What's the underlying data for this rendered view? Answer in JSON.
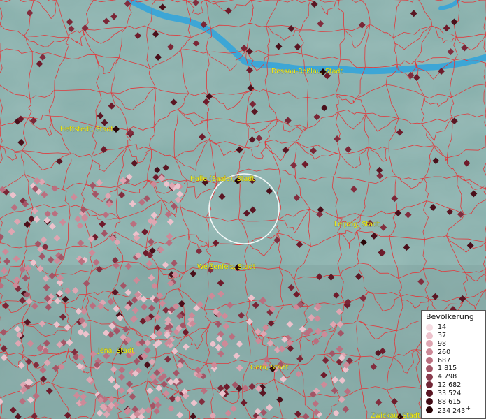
{
  "map": {
    "cities": [
      {
        "id": "dessau",
        "label": "Dessau-Roßlau, Stadt"
      },
      {
        "id": "hettstedt",
        "label": "Hettstedt, Stadt"
      },
      {
        "id": "halle",
        "label": "Halle (Saale), Stadt"
      },
      {
        "id": "leipzig",
        "label": "Leipzig, Stadt"
      },
      {
        "id": "weissenfels",
        "label": "Weißenfels, Stadt"
      },
      {
        "id": "jena",
        "label": "Jena, Stadt"
      },
      {
        "id": "gera",
        "label": "Gera, Stadt"
      },
      {
        "id": "zwickau",
        "label": "Zwickau, Stadt"
      }
    ],
    "colors": {
      "terrain": "#8fb5b0",
      "water": "#3da6d6",
      "boundaries": "#e0393c",
      "labels": "#f5f017",
      "focus_circle": "#ffffff"
    }
  },
  "legend": {
    "title": "Bevölkerung",
    "entries": [
      {
        "label": "14",
        "color": "#f6dde3"
      },
      {
        "label": "37",
        "color": "#ecc2cc"
      },
      {
        "label": "98",
        "color": "#dea6b2"
      },
      {
        "label": "260",
        "color": "#cd8a98"
      },
      {
        "label": "687",
        "color": "#ba6f7f"
      },
      {
        "label": "1 815",
        "color": "#a35566"
      },
      {
        "label": "4 798",
        "color": "#8a3c4e"
      },
      {
        "label": "12 682",
        "color": "#722737"
      },
      {
        "label": "33 524",
        "color": "#5a1623"
      },
      {
        "label": "88 615",
        "color": "#420b15"
      },
      {
        "label": "234 243",
        "color": "#290508",
        "plus": "+"
      }
    ]
  }
}
